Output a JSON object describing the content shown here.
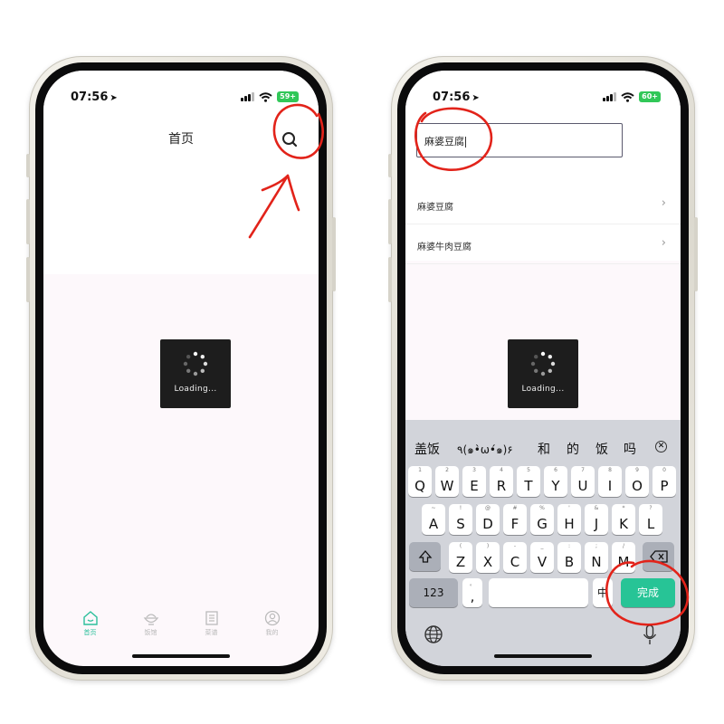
{
  "left_phone": {
    "status": {
      "time": "07:56",
      "battery": "59+"
    },
    "title": "首页",
    "loading_label": "Loading...",
    "tabs": [
      {
        "label": "首页",
        "icon": "home-icon",
        "active": true
      },
      {
        "label": "饭馆",
        "icon": "rice-bowl-icon",
        "active": false
      },
      {
        "label": "菜谱",
        "icon": "recipe-book-icon",
        "active": false
      },
      {
        "label": "我的",
        "icon": "profile-icon",
        "active": false
      }
    ]
  },
  "right_phone": {
    "status": {
      "time": "07:56",
      "battery": "60+"
    },
    "search": {
      "value": "麻婆豆腐"
    },
    "results": [
      "麻婆豆腐",
      "麻婆牛肉豆腐"
    ],
    "loading_label": "Loading...",
    "keyboard": {
      "candidates": [
        "盖饭",
        "٩(๑•̀ω•́๑)۶",
        "和",
        "的",
        "饭",
        "吗"
      ],
      "row1": [
        {
          "main": "Q",
          "sub": "1"
        },
        {
          "main": "W",
          "sub": "2"
        },
        {
          "main": "E",
          "sub": "3"
        },
        {
          "main": "R",
          "sub": "4"
        },
        {
          "main": "T",
          "sub": "5"
        },
        {
          "main": "Y",
          "sub": "6"
        },
        {
          "main": "U",
          "sub": "7"
        },
        {
          "main": "I",
          "sub": "8"
        },
        {
          "main": "O",
          "sub": "9"
        },
        {
          "main": "P",
          "sub": "0"
        }
      ],
      "row2": [
        {
          "main": "A",
          "sub": "~"
        },
        {
          "main": "S",
          "sub": "!"
        },
        {
          "main": "D",
          "sub": "@"
        },
        {
          "main": "F",
          "sub": "#"
        },
        {
          "main": "G",
          "sub": "%"
        },
        {
          "main": "H",
          "sub": "'"
        },
        {
          "main": "J",
          "sub": "&"
        },
        {
          "main": "K",
          "sub": "*"
        },
        {
          "main": "L",
          "sub": "?"
        }
      ],
      "row3": [
        {
          "main": "Z",
          "sub": "("
        },
        {
          "main": "X",
          "sub": ")"
        },
        {
          "main": "C",
          "sub": "-"
        },
        {
          "main": "V",
          "sub": "_"
        },
        {
          "main": "B",
          "sub": ":"
        },
        {
          "main": "N",
          "sub": ";"
        },
        {
          "main": "M",
          "sub": "/"
        }
      ],
      "numbers_key": "123",
      "comma_key": ",",
      "comma_sub": "。",
      "lang_key": "中",
      "done_key": "完成"
    }
  },
  "colors": {
    "accent": "#27c496",
    "annotation": "#e2231a",
    "loading_bg": "#1d1d1d",
    "keyboard_bg": "#d2d4da"
  }
}
